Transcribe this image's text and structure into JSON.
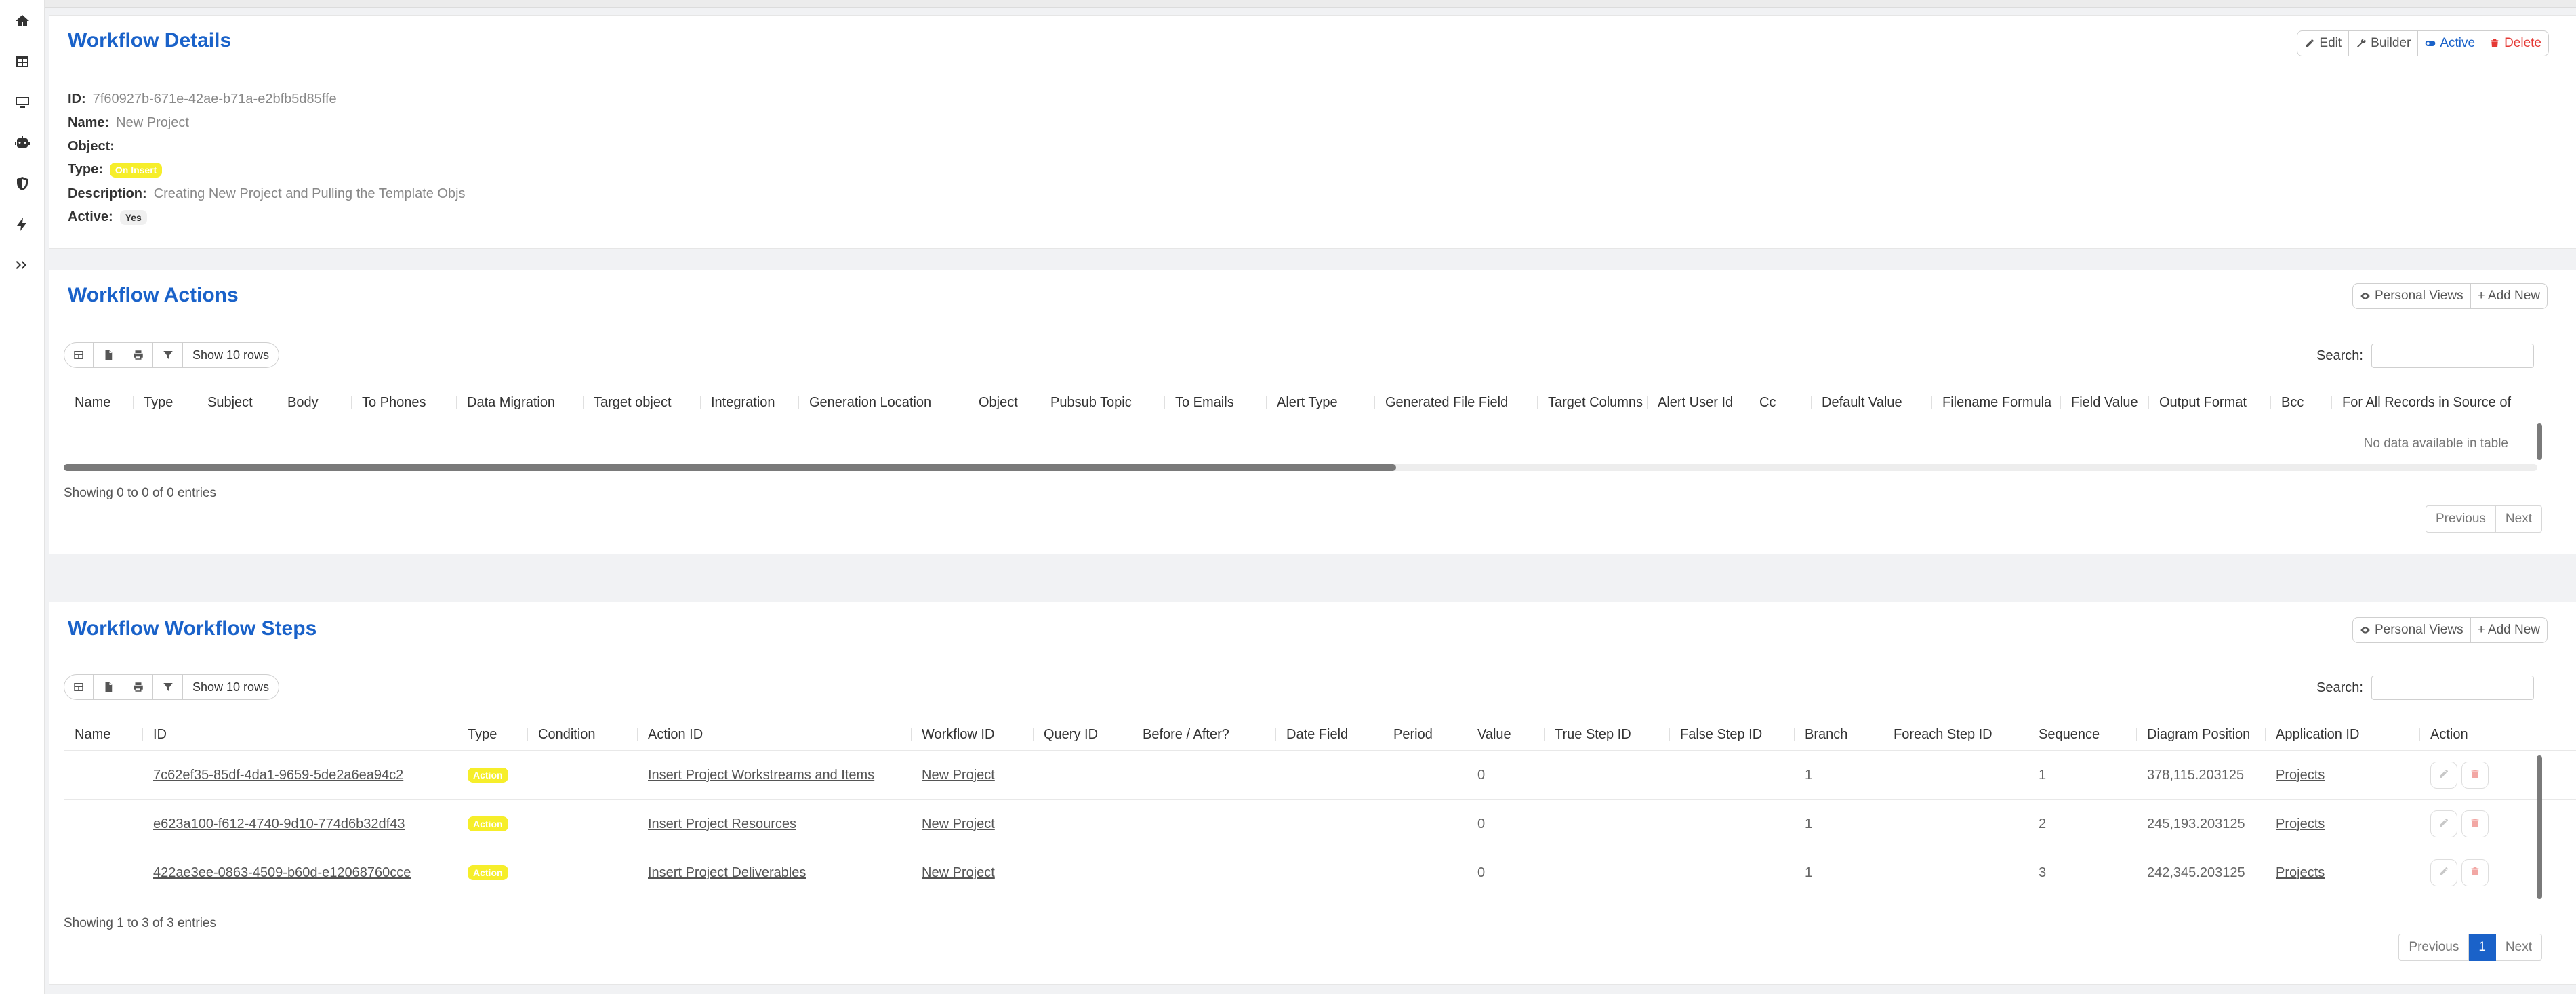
{
  "sidebar": {
    "icons": [
      "home-icon",
      "table-icon",
      "desktop-icon",
      "robot-icon",
      "shield-icon",
      "bolt-icon",
      "expand-icon"
    ]
  },
  "details": {
    "title": "Workflow Details",
    "buttons": {
      "edit": "Edit",
      "builder": "Builder",
      "active": "Active",
      "delete": "Delete"
    },
    "id_label": "ID:",
    "id_value": "7f60927b-671e-42ae-b71a-e2bfb5d85ffe",
    "name_label": "Name:",
    "name_value": "New Project",
    "object_label": "Object:",
    "type_label": "Type:",
    "type_value": "On Insert",
    "description_label": "Description:",
    "description_value": "Creating New Project and Pulling the Template Objs",
    "active_label": "Active:",
    "active_value": "Yes"
  },
  "actions": {
    "title": "Workflow Actions",
    "personal_views": "Personal Views",
    "add_new": "+ Add New",
    "show_rows": "Show 10 rows",
    "search_label": "Search:",
    "columns": [
      "Name",
      "Type",
      "Subject",
      "Body",
      "To Phones",
      "Data Migration",
      "Target object",
      "Integration",
      "Generation Location",
      "Object",
      "Pubsub Topic",
      "To Emails",
      "Alert Type",
      "Generated File Field",
      "Target Columns",
      "Alert User Id",
      "Cc",
      "Default Value",
      "Filename Formula",
      "Field Value",
      "Output Format",
      "Bcc",
      "For All Records in Source of"
    ],
    "empty": "No data available in table",
    "info": "Showing 0 to 0 of 0 entries",
    "prev": "Previous",
    "next": "Next"
  },
  "steps": {
    "title": "Workflow Workflow Steps",
    "personal_views": "Personal Views",
    "add_new": "+ Add New",
    "show_rows": "Show 10 rows",
    "search_label": "Search:",
    "columns": [
      "Name",
      "ID",
      "Type",
      "Condition",
      "Action ID",
      "Workflow ID",
      "Query ID",
      "Before / After?",
      "Date Field",
      "Period",
      "Value",
      "True Step ID",
      "False Step ID",
      "Branch",
      "Foreach Step ID",
      "Sequence",
      "Diagram Position",
      "Application ID",
      "Action"
    ],
    "rows": [
      {
        "id": "7c62ef35-85df-4da1-9659-5de2a6ea94c2",
        "type": "Action",
        "action_id": "Insert Project Workstreams and Items",
        "workflow_id": "New Project",
        "value": "0",
        "branch": "1",
        "sequence": "1",
        "diagram_position": "378,115.203125",
        "application_id": "Projects"
      },
      {
        "id": "e623a100-f612-4740-9d10-774d6b32df43",
        "type": "Action",
        "action_id": "Insert Project Resources",
        "workflow_id": "New Project",
        "value": "0",
        "branch": "1",
        "sequence": "2",
        "diagram_position": "245,193.203125",
        "application_id": "Projects"
      },
      {
        "id": "422ae3ee-0863-4509-b60d-e12068760cce",
        "type": "Action",
        "action_id": "Insert Project Deliverables",
        "workflow_id": "New Project",
        "value": "0",
        "branch": "1",
        "sequence": "3",
        "diagram_position": "242,345.203125",
        "application_id": "Projects"
      }
    ],
    "info": "Showing 1 to 3 of 3 entries",
    "prev": "Previous",
    "page": "1",
    "next": "Next"
  },
  "colors": {
    "accent": "#1a62c9",
    "danger": "#e53935",
    "badge": "#f6ee2a"
  }
}
